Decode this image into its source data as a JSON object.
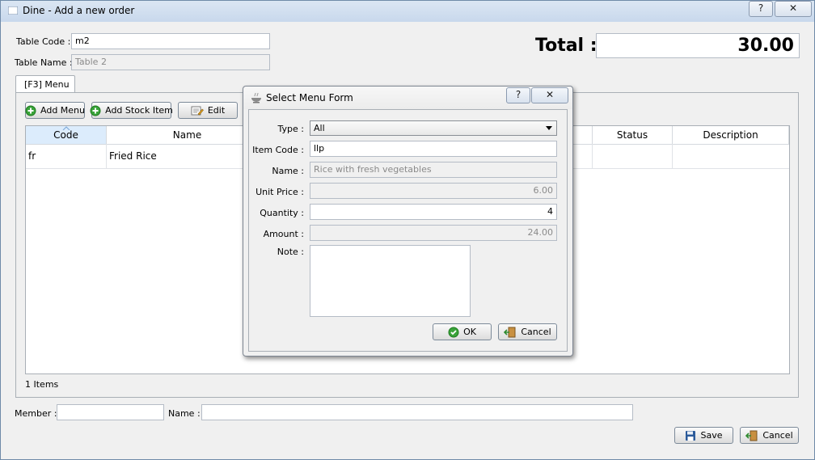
{
  "window": {
    "title": "Dine - Add a new order",
    "help_label": "?",
    "close_label": "✕"
  },
  "form": {
    "table_code_label": "Table Code :",
    "table_code_value": "m2",
    "table_name_label": "Table Name :",
    "table_name_value": "Table 2",
    "total_label": "Total :",
    "total_value": "30.00"
  },
  "menu_tab": {
    "label": "[F3] Menu",
    "add_menu_label": "Add Menu",
    "add_stock_label": "Add Stock Item",
    "edit_label": "Edit"
  },
  "grid": {
    "columns": [
      "Code",
      "Name",
      "Status",
      "Description"
    ],
    "rows": [
      {
        "code": "fr",
        "name": "Fried Rice",
        "status": "",
        "description": ""
      }
    ],
    "count_text": "1 Items"
  },
  "footer": {
    "member_label": "Member :",
    "member_value": "",
    "name_label": "Name :",
    "name_value": "",
    "save_label": "Save",
    "cancel_label": "Cancel"
  },
  "dialog": {
    "title": "Select Menu Form",
    "help_label": "?",
    "close_label": "✕",
    "type_label": "Type :",
    "type_value": "All",
    "item_code_label": "Item Code :",
    "item_code_value": "llp",
    "name_label": "Name :",
    "name_value": "Rice with fresh vegetables",
    "unit_price_label": "Unit Price :",
    "unit_price_value": "6.00",
    "quantity_label": "Quantity :",
    "quantity_value": "4",
    "amount_label": "Amount :",
    "amount_value": "24.00",
    "note_label": "Note :",
    "note_value": "",
    "ok_label": "OK",
    "cancel_label": "Cancel"
  },
  "icons": {
    "add": "plus-circle-icon",
    "edit": "edit-icon",
    "save": "floppy-icon",
    "cancel": "exit-door-icon",
    "ok": "check-circle-icon",
    "dialog": "food-bowl-icon"
  },
  "colors": {
    "title_gradient": "#c8d8ec",
    "header_selected": "#dcecfc",
    "add_icon_green": "#3aa33a"
  }
}
